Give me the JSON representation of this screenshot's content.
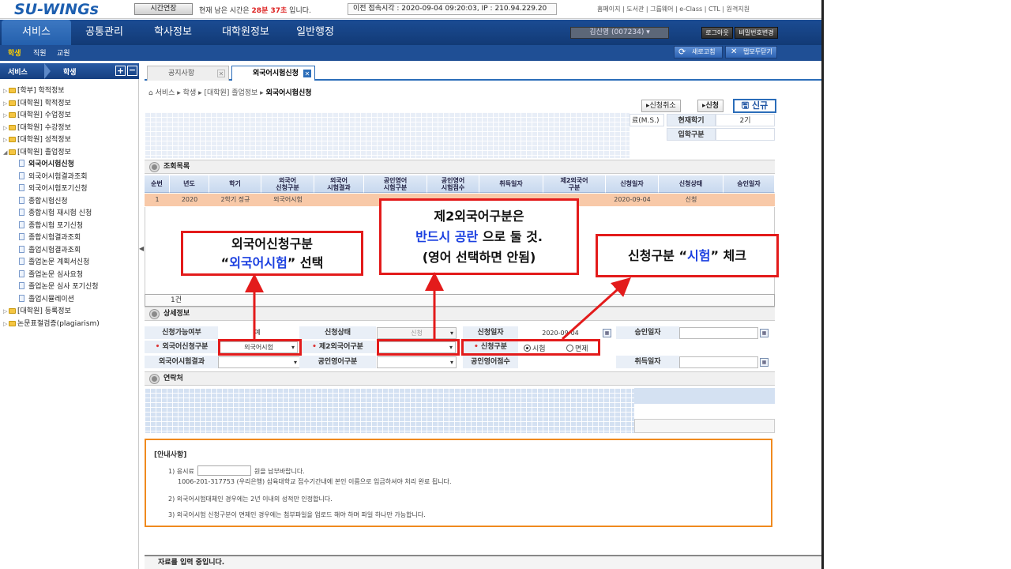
{
  "app": {
    "logo": "SU-WINGs",
    "time_extend_button": "시간연장",
    "remaining_prefix": "현재 남은 시간은 ",
    "remaining_value": "28분 37초",
    "remaining_suffix": " 입니다.",
    "last_login": "이전 접속시각 : 2020-09-04 09:20:03,  IP : 210.94.229.20",
    "top_links": "홈페이지 | 도서관 | 그룹웨어 | e-Class | CTL | 원격지원"
  },
  "nav": {
    "tabs": [
      "서비스",
      "공통관리",
      "학사정보",
      "대학원정보",
      "일반행정"
    ],
    "user": "김신영 (007234)",
    "logout": "로그아웃",
    "change_password": "비밀번호변경"
  },
  "subnav": {
    "items": [
      "학생",
      "직원",
      "교원"
    ],
    "refresh": "새로고침",
    "close_tabs": "탭모두닫기"
  },
  "sidebar": {
    "title": "서비스",
    "role": "학생",
    "items": [
      {
        "label": "[학부] 학적정보",
        "type": "folder"
      },
      {
        "label": "[대학원] 학적정보",
        "type": "folder"
      },
      {
        "label": "[대학원] 수업정보",
        "type": "folder"
      },
      {
        "label": "[대학원] 수강정보",
        "type": "folder"
      },
      {
        "label": "[대학원] 성적정보",
        "type": "folder"
      },
      {
        "label": "[대학원] 졸업정보",
        "type": "folder-open"
      },
      {
        "label": "외국어시험신청",
        "type": "doc",
        "active": true
      },
      {
        "label": "외국어시험결과조회",
        "type": "doc"
      },
      {
        "label": "외국어시험포기신청",
        "type": "doc"
      },
      {
        "label": "종합시험신청",
        "type": "doc"
      },
      {
        "label": "종합시험 재시험 신청",
        "type": "doc"
      },
      {
        "label": "종합시험 포기신청",
        "type": "doc"
      },
      {
        "label": "종합시험결과조회",
        "type": "doc"
      },
      {
        "label": "졸업시험결과조회",
        "type": "doc"
      },
      {
        "label": "졸업논문 계획서신청",
        "type": "doc"
      },
      {
        "label": "졸업논문 심사요청",
        "type": "doc"
      },
      {
        "label": "졸업논문 심사 포기신청",
        "type": "doc"
      },
      {
        "label": "졸업시뮬레이션",
        "type": "doc"
      },
      {
        "label": "[대학원] 등록정보",
        "type": "folder"
      },
      {
        "label": "논문표절검증(plagiarism)",
        "type": "folder"
      }
    ]
  },
  "content": {
    "tabs": [
      {
        "label": "공지사항",
        "active": false
      },
      {
        "label": "외국어시험신청",
        "active": true
      }
    ],
    "breadcrumb": {
      "path": "서비스 ▸ 학생 ▸ [대학원] 졸업정보 ▸ ",
      "current": "외국어시험신청"
    },
    "actions": {
      "cancel": "신청취소",
      "apply": "신청",
      "new": "신규"
    },
    "student_info": {
      "degree_label_tail": "료(M.S.)",
      "current_semester_label": "현재학기",
      "current_semester_value": "2기",
      "admission_type_label": "입학구분",
      "admission_type_value": ""
    },
    "list_section": {
      "title": "조회목록",
      "columns": [
        "순번",
        "년도",
        "학기",
        "외국어\n신청구분",
        "외국어\n시험결과",
        "공인영어\n시험구분",
        "공인영어\n시험점수",
        "취득일자",
        "제2외국어\n구분",
        "신청일자",
        "신청상태",
        "승인일자"
      ],
      "rows": [
        [
          "1",
          "2020",
          "2학기 정규",
          "외국어시험",
          "",
          "",
          "",
          "",
          "",
          "2020-09-04",
          "신청",
          ""
        ]
      ],
      "count": "1건"
    },
    "detail_section": {
      "title": "상세정보",
      "apply_possible_label": "신청가능여부",
      "apply_possible_value": "예",
      "status_label": "신청상태",
      "status_value": "신청",
      "apply_date_label": "신청일자",
      "apply_date_value": "2020-09-04",
      "approve_date_label": "승인일자",
      "approve_date_value": "",
      "lang_apply_type_label": "외국어신청구분",
      "lang_apply_type_value": "외국어시험",
      "second_lang_label": "제2외국어구분",
      "second_lang_value": "",
      "apply_type_label": "신청구분",
      "apply_type_options": [
        "시험",
        "면제"
      ],
      "apply_type_selected": "시험",
      "lang_result_label": "외국어시험결과",
      "lang_result_value": "",
      "eng_type_label": "공인영어구분",
      "eng_type_value": "",
      "eng_score_label": "공인영어점수",
      "eng_score_value": "",
      "acquire_date_label": "취득일자",
      "acquire_date_value": ""
    },
    "contact_section": {
      "title": "연락처"
    },
    "notice": {
      "title": "[안내사항]",
      "line1_prefix": "1) 응시료",
      "line1_suffix": "원을 납부바랍니다.",
      "line1_account": "1006-201-317753 (우리은행) 삼육대학교 접수기간내에  본인 이름으로 입금하셔야 처리 완료 됩니다.",
      "line2": "2) 외국어시험대체인 경우에는 2년 이내의 성적만 인정합니다.",
      "line3": "3) 외국어시험 신청구분이 면제인 경우에는 첨부파일을 업로드 해야 하며 파일 하나만 가능합니다."
    },
    "status_bar": "자료를 입력 중입니다."
  },
  "annotations": {
    "callout1_line1": "외국어신청구분",
    "callout1_q1": "“",
    "callout1_highlight": "외국어시험",
    "callout1_q2": "”",
    "callout1_tail": " 선택",
    "callout2_line1": "제2외국어구분은",
    "callout2_highlight": "반드시 공란",
    "callout2_tail": " 으로 둘 것.",
    "callout2_line3": "(영어 선택하면 안됨)",
    "callout3_prefix": "신청구분 “",
    "callout3_highlight": "시험",
    "callout3_suffix": "” 체크",
    "highlight_color": "#e31b1b",
    "accent_color": "#1a3fe0"
  }
}
